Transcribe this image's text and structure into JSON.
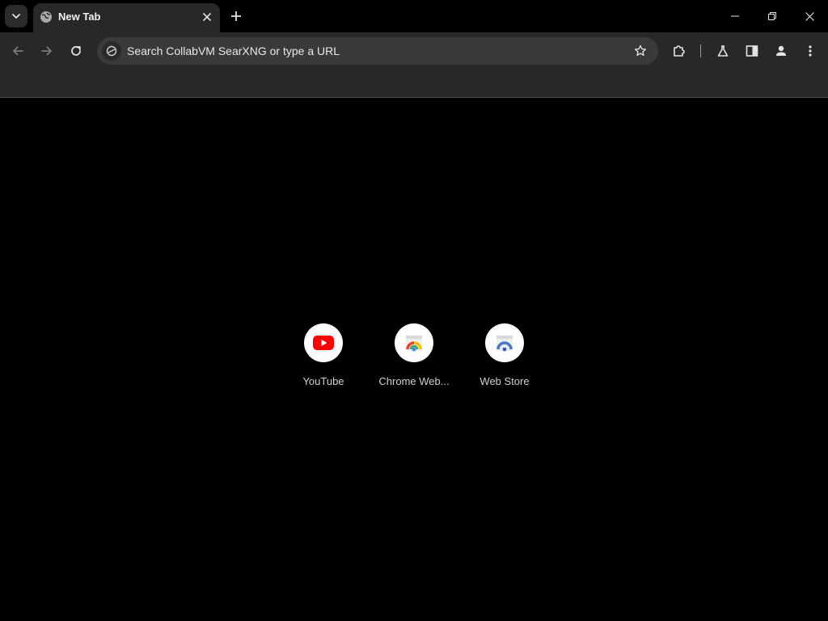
{
  "tabs": [
    {
      "title": "New Tab",
      "favicon": "globe-icon",
      "active": true
    }
  ],
  "omnibox": {
    "placeholder": "Search CollabVM SearXNG or type a URL"
  },
  "shortcuts": [
    {
      "label": "YouTube",
      "icon": "youtube-icon"
    },
    {
      "label": "Chrome Web...",
      "icon": "chrome-web-store-icon"
    },
    {
      "label": "Web Store",
      "icon": "web-store-icon"
    }
  ],
  "colors": {
    "tab_background": "#282828",
    "toolbar_background": "#282828",
    "omnibox_background": "#3a3a3a",
    "page_background": "#000000",
    "youtube_red": "#ff0000"
  }
}
